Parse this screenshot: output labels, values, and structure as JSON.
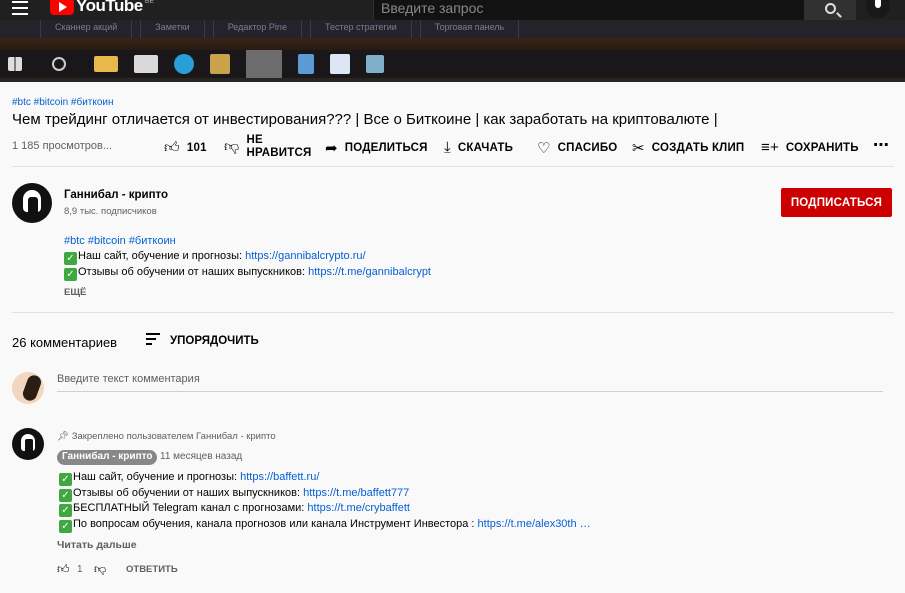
{
  "header": {
    "logo_text": "YouTube",
    "logo_region": "BE",
    "search_placeholder": "Введите запрос"
  },
  "embedded_screen": {
    "tabs": [
      "Сканнер акций",
      "Заметки",
      "Редактор Pine",
      "Тестер стратегии",
      "Торговая панель"
    ]
  },
  "video": {
    "tags": "#btc #bitcoin #биткоин",
    "title": "Чем трейдинг отличается от инвестирования??? | Все о Биткоине | как заработать на криптовалюте |",
    "views": "1 185 просмотров...",
    "actions": {
      "like_count": "101",
      "dislike_line1": "НЕ",
      "dislike_line2": "НРАВИТСЯ",
      "share": "ПОДЕЛИТЬСЯ",
      "download": "СКАЧАТЬ",
      "thanks": "СПАСИБО",
      "clip": "СОЗДАТЬ КЛИП",
      "save": "СОХРАНИТЬ"
    }
  },
  "channel": {
    "name": "Ганнибал - крипто",
    "subscribers": "8,9 тыс. подписчиков",
    "subscribe_label": "ПОДПИСАТЬСЯ"
  },
  "description": {
    "hashtags": "#btc  #bitcoin  #биткоин",
    "line1_text": "Наш сайт, обучение и прогнозы: ",
    "line1_link": "https://gannibalcrypto.ru/",
    "line2_text": "Отзывы об обучении от наших выпускников: ",
    "line2_link": "https://t.me/gannibalcrypt",
    "more_label": "ЕЩЁ"
  },
  "comments": {
    "count_label": "26 комментариев",
    "sort_label": "УПОРЯДОЧИТЬ",
    "input_placeholder": "Введите текст комментария",
    "pinned": {
      "pinned_label": "Закреплено пользователем Ганнибал - крипто",
      "author": "Ганнибал - крипто",
      "time": "11 месяцев назад",
      "lines": [
        {
          "text": "Наш сайт, обучение и прогнозы: ",
          "link": "https://baffett.ru/"
        },
        {
          "text": "Отзывы об обучении от наших выпускников: ",
          "link": "https://t.me/baffett777"
        },
        {
          "text": "БЕСПЛАТНЫЙ Telegram канал с прогнозами: ",
          "link": "https://t.me/crybaffett"
        },
        {
          "text": "По вопросам обучения, канала прогнозов или канала Инструмент Инвестора : ",
          "link": "https://t.me/alex30th …"
        }
      ],
      "read_more": "Читать дальше",
      "like_count": "1",
      "reply_label": "ОТВЕТИТЬ"
    }
  }
}
